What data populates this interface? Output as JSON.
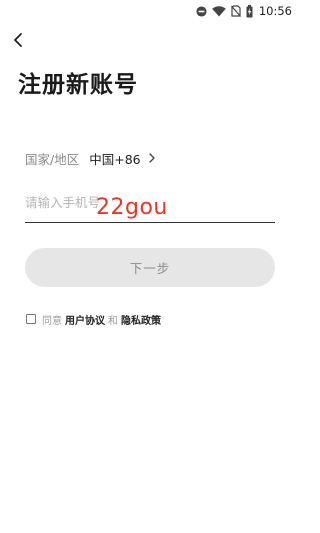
{
  "status_bar": {
    "time": "10:56",
    "icons": [
      "do-not-disturb-icon",
      "wifi-icon",
      "no-sim-icon",
      "battery-charging-icon"
    ]
  },
  "header": {
    "back_icon": "chevron-left-icon",
    "title": "注册新账号"
  },
  "form": {
    "region_label": "国家/地区",
    "region_value": "中国+86",
    "region_chevron_icon": "chevron-right-icon",
    "phone_placeholder": "请输入手机号",
    "phone_value": "",
    "next_label": "下一步"
  },
  "watermark": "22gou",
  "agreement": {
    "checked": false,
    "prefix": "同意",
    "user_agreement": "用户协议",
    "and": "和",
    "privacy_policy": "隐私政策"
  },
  "colors": {
    "title": "#1a1a1a",
    "muted_text": "#8a8a8a",
    "button_bg": "#e6e6e6",
    "button_text": "#8c8c8c",
    "watermark": "#e8362a"
  }
}
